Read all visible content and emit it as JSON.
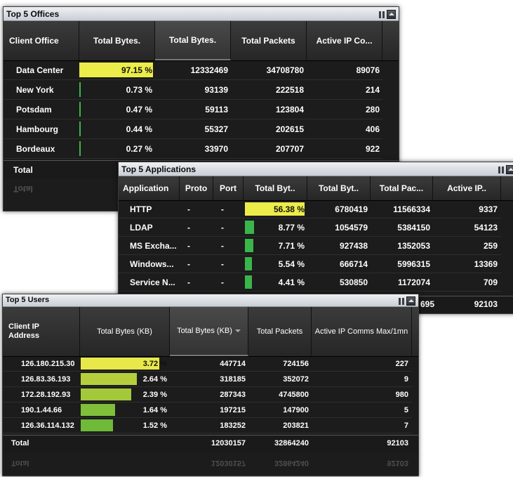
{
  "offices": {
    "title": "Top 5 Offices",
    "headers": [
      "Client Office",
      "Total Bytes.",
      "Total Bytes.",
      "Total Packets",
      "Active IP Co..."
    ],
    "rows": [
      {
        "name": "Data Center",
        "pct": "97.15 %",
        "bytes": "12332469",
        "packets": "34708780",
        "active": "89076",
        "bar": 0.9715
      },
      {
        "name": "New York",
        "pct": "0.73 %",
        "bytes": "93139",
        "packets": "222518",
        "active": "214",
        "bar": 0.0073
      },
      {
        "name": "Potsdam",
        "pct": "0.47 %",
        "bytes": "59113",
        "packets": "123804",
        "active": "280",
        "bar": 0.0047
      },
      {
        "name": "Hambourg",
        "pct": "0.44 %",
        "bytes": "55327",
        "packets": "202615",
        "active": "406",
        "bar": 0.0044
      },
      {
        "name": "Bordeaux",
        "pct": "0.27 %",
        "bytes": "33970",
        "packets": "207707",
        "active": "922",
        "bar": 0.0027
      }
    ],
    "total_label": "Total"
  },
  "apps": {
    "title": "Top 5 Applications",
    "headers": [
      "Application",
      "Proto",
      "Port",
      "Total Byt..",
      "Total Byt..",
      "Total Pac...",
      "Active IP.."
    ],
    "rows": [
      {
        "name": "HTTP",
        "proto": "-",
        "port": "-",
        "pct": "56.38 %",
        "bytes": "6780419",
        "packets": "11566334",
        "active": "9337",
        "bar": 0.5638,
        "color": "yellow"
      },
      {
        "name": "LDAP",
        "proto": "-",
        "port": "-",
        "pct": "8.77 %",
        "bytes": "1054579",
        "packets": "5384150",
        "active": "54123",
        "bar": 0.0877,
        "color": "green"
      },
      {
        "name": "MS Excha...",
        "proto": "-",
        "port": "-",
        "pct": "7.71 %",
        "bytes": "927438",
        "packets": "1352053",
        "active": "259",
        "bar": 0.0771,
        "color": "green"
      },
      {
        "name": "Windows...",
        "proto": "-",
        "port": "-",
        "pct": "5.54 %",
        "bytes": "666714",
        "packets": "5996315",
        "active": "13369",
        "bar": 0.0554,
        "color": "green"
      },
      {
        "name": "Service N...",
        "proto": "-",
        "port": "-",
        "pct": "4.41 %",
        "bytes": "530850",
        "packets": "1172074",
        "active": "709",
        "bar": 0.0441,
        "color": "green"
      }
    ],
    "total_packets_partial": "695",
    "total_active": "92103"
  },
  "users": {
    "title": "Top 5 Users",
    "headers": [
      "Client IP Address",
      "Total Bytes (KB)",
      "Total Bytes (KB)",
      "Total Packets",
      "Active IP Comms Max/1mn"
    ],
    "rows": [
      {
        "ip": "126.180.215.30",
        "pct": "3.72 %",
        "bytes": "447714",
        "packets": "724156",
        "active": "227",
        "bar": 1.0,
        "color": "#e8e84a"
      },
      {
        "ip": "126.83.36.193",
        "pct": "2.64 %",
        "bytes": "318185",
        "packets": "352072",
        "active": "9",
        "bar": 0.71,
        "color": "#b5cf3c"
      },
      {
        "ip": "172.28.192.93",
        "pct": "2.39 %",
        "bytes": "287343",
        "packets": "4745800",
        "active": "980",
        "bar": 0.64,
        "color": "#a3c93a"
      },
      {
        "ip": "190.1.44.66",
        "pct": "1.64 %",
        "bytes": "197215",
        "packets": "147900",
        "active": "5",
        "bar": 0.44,
        "color": "#7fbf3a"
      },
      {
        "ip": "126.36.114.132",
        "pct": "1.52 %",
        "bytes": "183252",
        "packets": "203821",
        "active": "7",
        "bar": 0.41,
        "color": "#6fba38"
      }
    ],
    "total_label": "Total",
    "total_bytes": "12030157",
    "total_packets": "32864240",
    "total_active": "92103"
  },
  "colors": {
    "yellow": "#ecec4a",
    "green": "#3ab54a"
  }
}
